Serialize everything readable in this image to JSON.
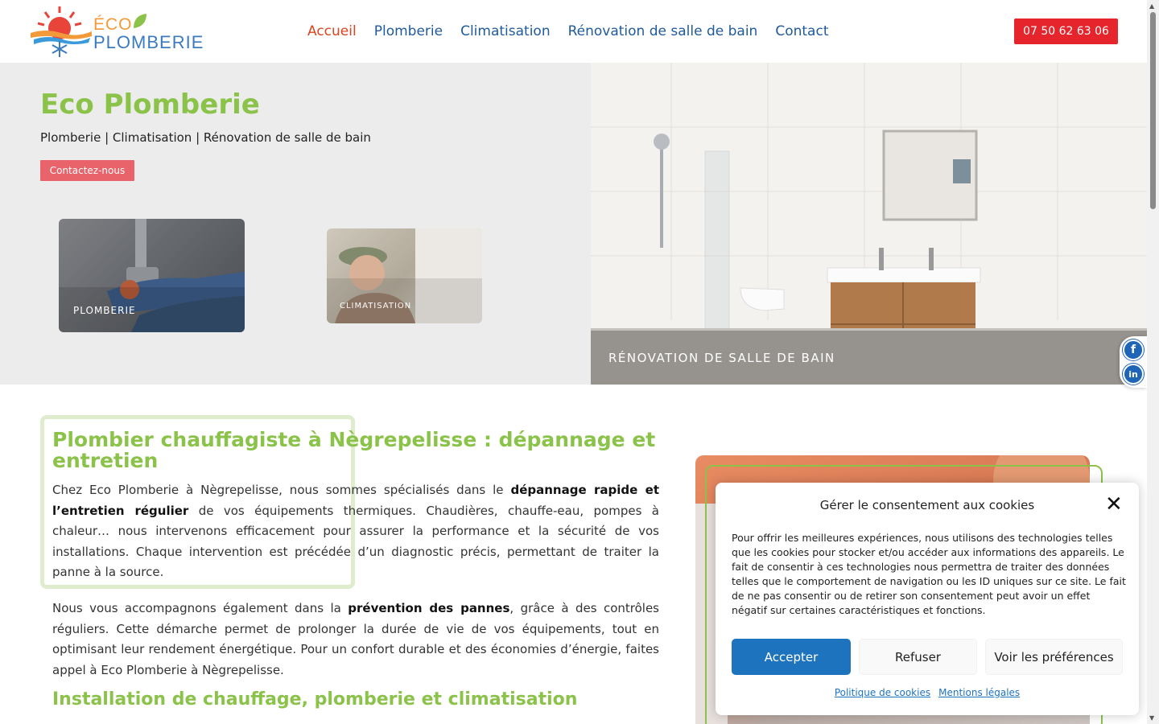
{
  "header": {
    "logo_line1": "ÉCO",
    "logo_line2": "PLOMBERIE",
    "nav": [
      {
        "label": "Accueil",
        "active": true
      },
      {
        "label": "Plomberie"
      },
      {
        "label": "Climatisation"
      },
      {
        "label": "Rénovation de salle de bain"
      },
      {
        "label": "Contact"
      }
    ],
    "phone": "07 50 62 63 06"
  },
  "hero": {
    "title": "Eco Plomberie",
    "subtitle": "Plomberie | Climatisation | Rénovation de salle de bain",
    "cta": "Contactez-nous",
    "cards": {
      "plomberie": "PLOMBERIE",
      "climatisation": "CLIMATISATION",
      "renovation": "RÉNOVATION DE SALLE DE BAIN"
    }
  },
  "social": {
    "facebook": "f",
    "linkedin": "in"
  },
  "content": {
    "title": "Plombier chauffagiste à Nègrepelisse : dépannage et entretien",
    "p1_a": "Chez Eco Plomberie à Nègrepelisse, nous sommes spécialisés dans le ",
    "p1_b": "dépannage rapide et l’entretien régulier",
    "p1_c": " de vos équipements thermiques. Chaudières, chauffe-eau, pompes à chaleur… nous intervenons efficacement pour assurer la performance et la sécurité de vos installations. Chaque intervention est précédée d’un diagnostic précis, permettant de traiter la panne à la source.",
    "p2_a": "Nous vous accompagnons également dans la ",
    "p2_b": "prévention des pannes",
    "p2_c": ", grâce à des contrôles réguliers. Cette démarche permet de prolonger la durée de vie de vos équipements, tout en optimisant leur rendement énergétique. Pour un confort durable et des économies d’énergie, faites appel à Eco Plomberie à Nègrepelisse.",
    "subtitle2": "Installation de chauffage, plomberie et climatisation"
  },
  "cookie": {
    "title": "Gérer le consentement aux cookies",
    "close": "✕",
    "text": "Pour offrir les meilleures expériences, nous utilisons des technologies telles que les cookies pour stocker et/ou accéder aux informations des appareils. Le fait de consentir à ces technologies nous permettra de traiter des données telles que le comportement de navigation ou les ID uniques sur ce site. Le fait de ne pas consentir ou de retirer son consentement peut avoir un effet négatif sur certaines caractéristiques et fonctions.",
    "accept": "Accepter",
    "refuse": "Refuser",
    "prefs": "Voir les préférences",
    "link_cookies": "Politique de cookies",
    "link_legal": "Mentions légales"
  },
  "colors": {
    "brand_green": "#8bc34a",
    "nav_blue": "#1f5a9c",
    "active_orange": "#d9441f",
    "phone_red": "#e5242c",
    "accept_blue": "#1e73be"
  }
}
